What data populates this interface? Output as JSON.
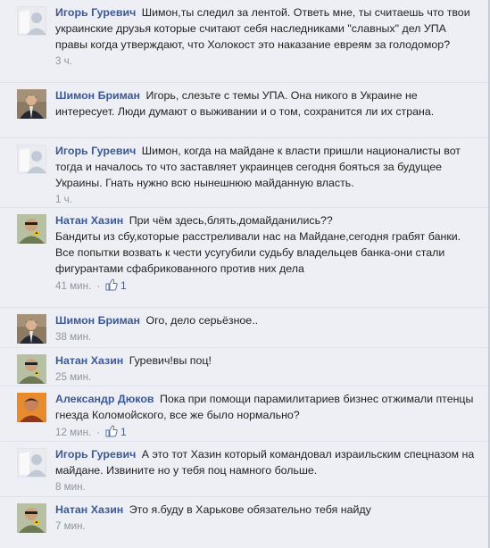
{
  "comments": [
    {
      "author": "Игорь Гуревич",
      "text": "Шимон,ты следил за лентой. Ответь мне, ты считаешь что твои украинские друзья которые считают себя наследниками \"славных\" дел УПА правы когда утверждают, что Холокост это наказание евреям за голодомор?",
      "time": "3 ч.",
      "likes": null,
      "avatar": "blank-avatar"
    },
    {
      "author": "Шимон Бриман",
      "text": "Игорь, слезьте с темы УПА. Она никого в Украине не интересует. Люди думают о выживании и о том, сохранится ли их страна.",
      "time": "",
      "likes": null,
      "avatar": "photo-avatar-man-suit"
    },
    {
      "author": "Игорь Гуревич",
      "text": "Шимон, когда на майдане к власти пришли националисты вот тогда и началось то что заставляет украинцев сегодня бояться за будущее Украины. Гнать нужно всю нынешнюю майданную власть.",
      "time": "1 ч.",
      "likes": null,
      "avatar": "blank-avatar"
    },
    {
      "author": "Натан Хазин",
      "text": "При чём здесь,блять,домайданились??\nБандиты из сбу,которые расстреливали нас на Майдане,сегодня грабят банки.\nВсе попытки возвать к чести усугубили судьбу владельцев банка-они стали фигурантами сфабрикованного против них дела",
      "time": "41 мин.",
      "likes": "1",
      "avatar": "photo-avatar-star-of-david"
    },
    {
      "author": "Шимон Бриман",
      "text": "Ого, дело серьёзное..",
      "time": "38 мин.",
      "likes": null,
      "avatar": "photo-avatar-man-suit"
    },
    {
      "author": "Натан Хазин",
      "text": "Гуревич!вы поц!",
      "time": "25 мин.",
      "likes": null,
      "avatar": "photo-avatar-star-of-david"
    },
    {
      "author": "Александр Дюков",
      "text": "Пока при помощи парамилитариев бизнес отжимали птенцы гнезда Коломойского, все же было нормально?",
      "time": "12 мин.",
      "likes": "1",
      "avatar": "photo-avatar-man-orange"
    },
    {
      "author": "Игорь Гуревич",
      "text": "А это тот Хазин который командовал израильским спецназом на майдане. Извините но у тебя поц намного больше.",
      "time": "8 мин.",
      "likes": null,
      "avatar": "blank-avatar"
    },
    {
      "author": "Натан Хазин",
      "text": "Это я.буду в Харькове обязательно тебя найду",
      "time": "7 мин.",
      "likes": null,
      "avatar": "photo-avatar-star-of-david"
    }
  ],
  "colors": {
    "author": "#3b5998",
    "background": "#edeff4",
    "meta": "#8f969f"
  }
}
